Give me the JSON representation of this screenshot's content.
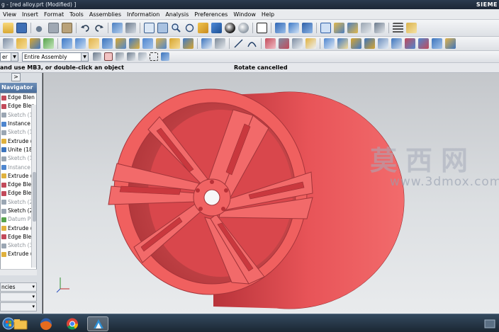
{
  "window": {
    "title": "g - [red alloy.prt (Modified) ]",
    "brand": "SIEME"
  },
  "menu": [
    "View",
    "Insert",
    "Format",
    "Tools",
    "Assemblies",
    "Information",
    "Analysis",
    "Preferences",
    "Window",
    "Help"
  ],
  "selection_bar": {
    "filter_value": "er",
    "scope_value": "Entire Assembly"
  },
  "cue_line": {
    "cue": "and use MB3, or double-click an object",
    "status": "Rotate cancelled"
  },
  "navigator": {
    "tab_glyph": ">",
    "title": "Navigator",
    "features": [
      {
        "label": "Edge Blen",
        "icon": "edge-blend-icon",
        "dim": false
      },
      {
        "label": "Edge Blen",
        "icon": "edge-blend-icon",
        "dim": false
      },
      {
        "label": "Sketch (1(",
        "icon": "sketch-icon",
        "dim": true
      },
      {
        "label": "Instance G",
        "icon": "instance-icon",
        "dim": false
      },
      {
        "label": "Sketch (1(",
        "icon": "sketch-icon",
        "dim": true
      },
      {
        "label": "Extrude (1",
        "icon": "extrude-icon",
        "dim": false
      },
      {
        "label": "Unite (18)",
        "icon": "unite-icon",
        "dim": false
      },
      {
        "label": "Sketch (1(",
        "icon": "sketch-icon",
        "dim": true
      },
      {
        "label": "Instance G",
        "icon": "instance-icon",
        "dim": true
      },
      {
        "label": "Extrude (2",
        "icon": "extrude-icon",
        "dim": false
      },
      {
        "label": "Edge Blen",
        "icon": "edge-blend-icon",
        "dim": false
      },
      {
        "label": "Edge Blen",
        "icon": "edge-blend-icon",
        "dim": false
      },
      {
        "label": "Sketch (2(",
        "icon": "sketch-icon",
        "dim": true
      },
      {
        "label": "Sketch (29",
        "icon": "sketch-icon",
        "dim": false
      },
      {
        "label": "Datum Pla",
        "icon": "datum-plane-icon",
        "dim": true
      },
      {
        "label": "Extrude (3",
        "icon": "extrude-icon",
        "dim": false
      },
      {
        "label": "Edge Blen",
        "icon": "edge-blend-icon",
        "dim": false
      },
      {
        "label": "Sketch (3(",
        "icon": "sketch-icon",
        "dim": true
      },
      {
        "label": "Extrude (3",
        "icon": "extrude-icon",
        "dim": false
      }
    ],
    "panels": [
      {
        "label": "ncies"
      },
      {
        "label": ""
      },
      {
        "label": ""
      }
    ]
  },
  "viewport": {
    "model": "red alloy wheel",
    "model_color": "#ef5b5b",
    "background_top": "#c4c7cb",
    "background_bottom": "#e9ebed",
    "watermark_cn": "莫西网",
    "watermark_url": "www.3dmox.com"
  },
  "taskbar": {
    "apps": [
      "start-orb",
      "file-explorer",
      "firefox",
      "chrome",
      "nx"
    ]
  }
}
